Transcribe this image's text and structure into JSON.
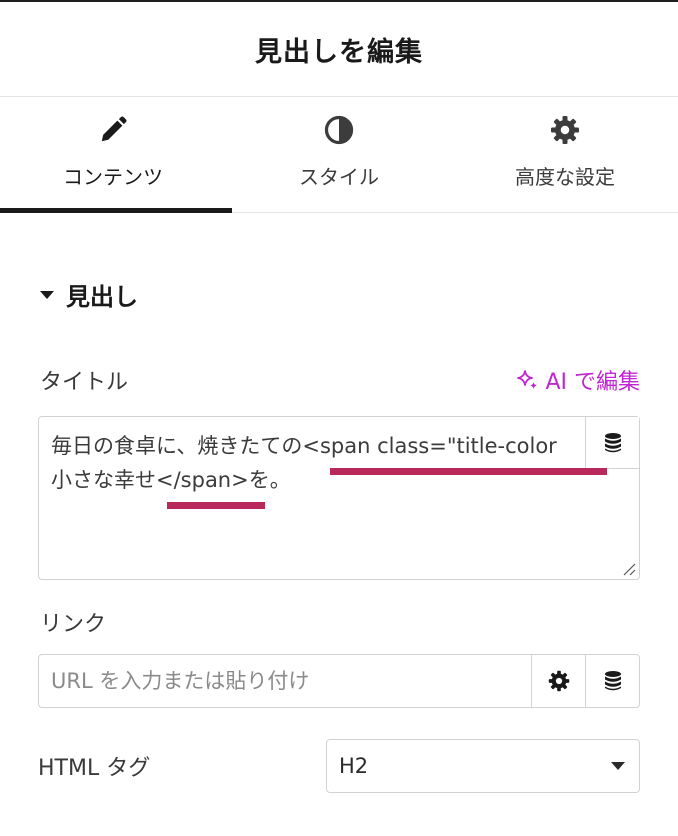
{
  "header": {
    "title": "見出しを編集"
  },
  "tabs": [
    {
      "label": "コンテンツ",
      "icon": "pencil-icon",
      "active": true
    },
    {
      "label": "スタイル",
      "icon": "half-circle-icon",
      "active": false
    },
    {
      "label": "高度な設定",
      "icon": "gear-icon",
      "active": false
    }
  ],
  "section": {
    "title": "見出し"
  },
  "title_field": {
    "label": "タイトル",
    "ai_label": "AI で編集",
    "line1": "毎日の食卓に、焼きたての<span class=\"title-color",
    "line2": "小さな幸せ</span>を。"
  },
  "link_field": {
    "label": "リンク",
    "placeholder": "URL を入力または貼り付け"
  },
  "html_tag": {
    "label": "HTML タグ",
    "value": "H2"
  },
  "colors": {
    "accent_ai": "#c026d3",
    "highlight_underline": "#b8285a",
    "text": "#1a1a1a"
  }
}
